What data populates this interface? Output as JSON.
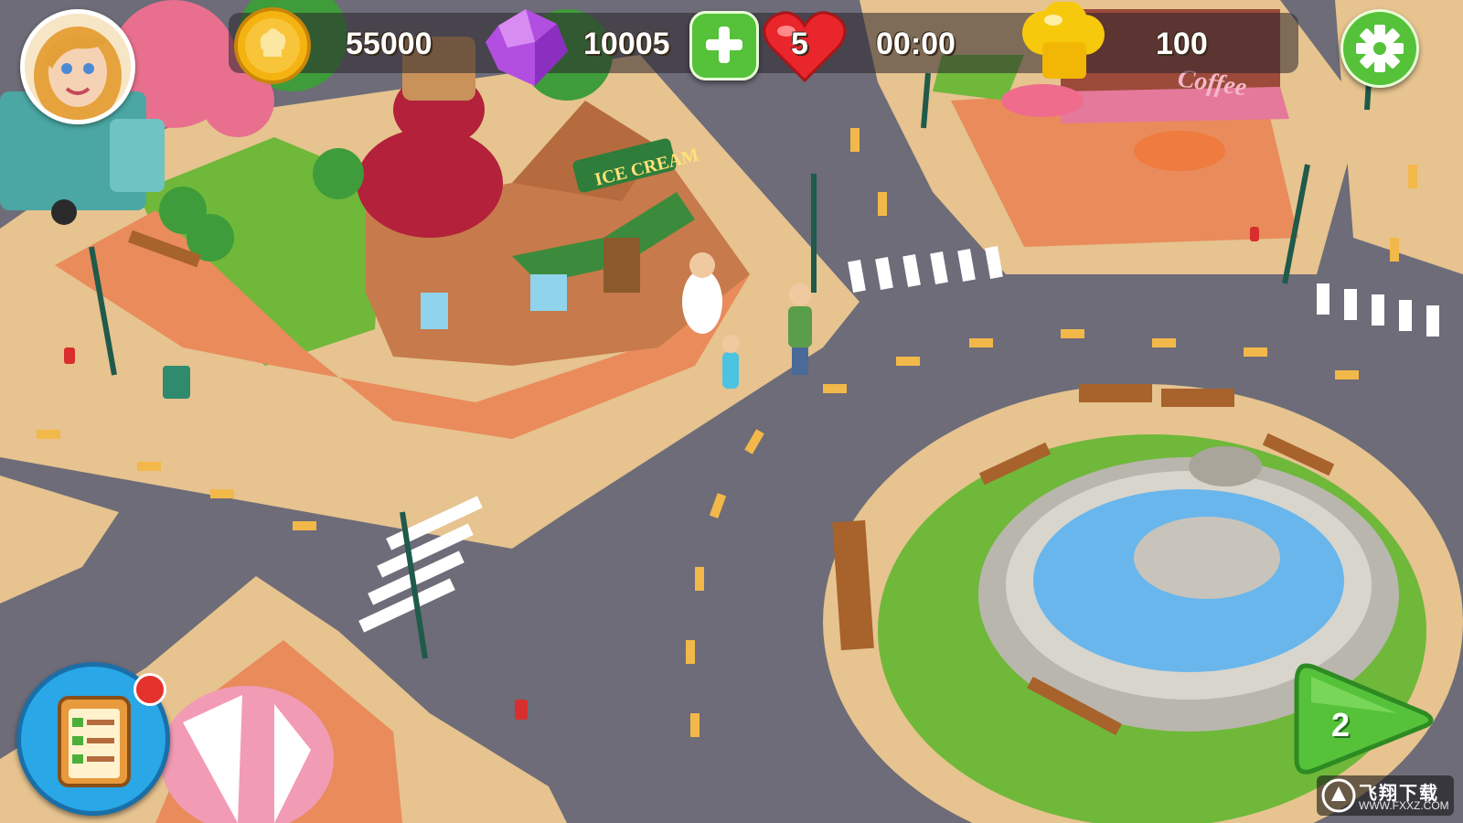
{
  "hud": {
    "coins": "55000",
    "gems": "10005",
    "lives": "5",
    "timer": "00:00",
    "chef_hats": "100",
    "level": "2"
  },
  "scene": {
    "ice_cream_sign": "ICE CREAM",
    "coffee_sign": "Coffee"
  },
  "watermark": {
    "title": "飞翔下载",
    "url": "WWW.FXXZ.COM"
  },
  "colors": {
    "road": "#6d6c78",
    "sidewalk": "#e6c38f",
    "plaza": "#e98b5b",
    "grass": "#6fb83a",
    "water": "#69b6ec",
    "coin": "#f5b312",
    "gem": "#b24fe0",
    "heart": "#e8262b",
    "green_button": "#55c23a",
    "task_button": "#29a7e6"
  }
}
